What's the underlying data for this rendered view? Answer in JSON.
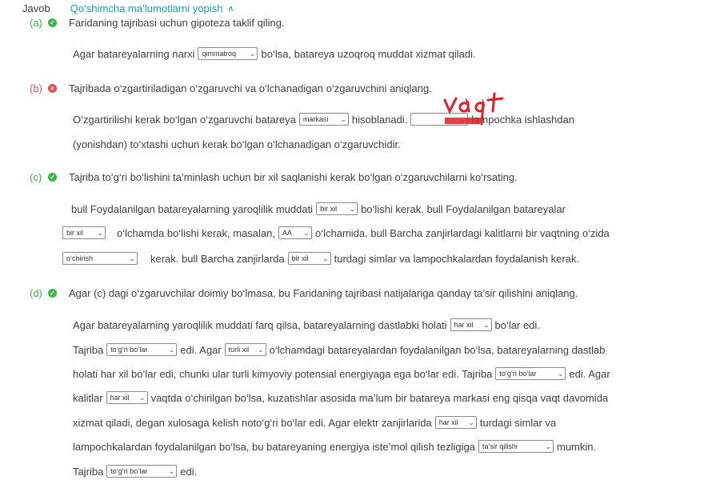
{
  "header": {
    "javob": "Javob",
    "toggle": "Qo‘shimcha ma’lumotlarni yopish"
  },
  "a": {
    "label": "(a)",
    "question": "Faridaning tajribasi uchun gipoteza taklif qiling.",
    "s1": "Agar batareyalarning narxi",
    "dd1": "qimmatroq",
    "s2": "bo‘lsa, batareya uzoqroq muddat xizmat qiladi."
  },
  "b": {
    "label": "(b)",
    "question": "Tajribada o‘zgartiriladigan o‘zgaruvchi va o‘lchanadigan o‘zgaruvchini aniqlang.",
    "s1": "O‘zgartirilishi kerak bo‘lgan o‘zgaruvchi batareya",
    "dd1": "markasi",
    "s2": "hisoblanadi.",
    "s3": "lampochka ishlashdan",
    "s4": "(yonishdan) to‘xtashi uchun kerak bo‘lgan o‘lchanadigan o‘zgaruvchidir.",
    "handwriting": "vaqt"
  },
  "c": {
    "label": "(c)",
    "question": "Tajriba to‘g‘ri bo‘lishini ta’minlash uchun bir xil saqlanishi kerak bo‘lgan o‘zgaruvchilarni ko‘rsating.",
    "l1a": "bull Foydalanilgan batareyalarning yaroqlilik muddati",
    "dd1": "bir xil",
    "l1b": "bo‘lishi kerak. bull Foydalanilgan batareyalar",
    "dd2": "bir xil",
    "l2a": "o‘lchamda bo‘lishi kerak, masalan,",
    "dd3": "AA",
    "l2b": "o‘lchamida. bull Barcha zanjirlardagi kalitlarni bir vaqtning o‘zida",
    "dd4": "o‘chirish",
    "l3a": "kerak. bull Barcha zanjirlarda",
    "dd5": "bir xil",
    "l3b": "turdagi simlar va lampochkalardan foydalanish kerak."
  },
  "d": {
    "label": "(d)",
    "question": "Agar (c) dagi o‘zgaruvchilar doimiy bo‘lmasa, bu Faridaning tajribasi natijalariga qanday ta’sir qilishini aniqlang.",
    "l1a": "Agar batareyalarning yaroqlilik muddati farq qilsa, batareyalarning dastlabki holati",
    "dd1": "har xil",
    "l1b": "bo‘lar edi.",
    "l2a": "Tajriba",
    "dd2": "to‘g‘ri bo‘lar",
    "l2b": "edi. Agar",
    "dd3": "turli xil",
    "l2c": "o‘lchamdagi batareyalardan foydalanilgan bo‘lsa, batareyalarning dastlab",
    "l3a": "holati har xil bo‘lar edi, chunki ular turli kimyoviy potensial energiyaga ega bo‘lar edi. Tajriba",
    "dd4": "to‘g‘ri bo‘lar",
    "l3b": "edi. Agar",
    "l4a": "kalitlar",
    "dd5": "har xil",
    "l4b": "vaqtda o‘chirilgan bo‘lsa, kuzatishlar asosida ma’lum bir batareya markasi eng qisqa vaqt davomida",
    "l5a": "xizmat qiladi, degan xulosaga kelish noto‘g‘ri bo‘lar edi. Agar elektr zanjirlarida",
    "dd6": "har xil",
    "l5b": "turdagi simlar va",
    "l6a": "lampochkalardan foydalanilgan bo‘lsa, bu batareyaning energiya iste’mol qilish tezligiga",
    "dd7": "ta’sir qilishi",
    "l6b": "mumkin.",
    "l7a": "Tajriba",
    "dd8": "to‘g‘ri bo‘lar",
    "l7b": "edi."
  },
  "colors": {
    "accent": "#1aa3b8",
    "correct": "#3cb54a",
    "incorrect": "#e05454",
    "handwriting": "#e0202a"
  },
  "icons": {
    "toggle": "chevron-up-icon",
    "correct": "check-circle-icon",
    "incorrect": "x-circle-icon"
  }
}
